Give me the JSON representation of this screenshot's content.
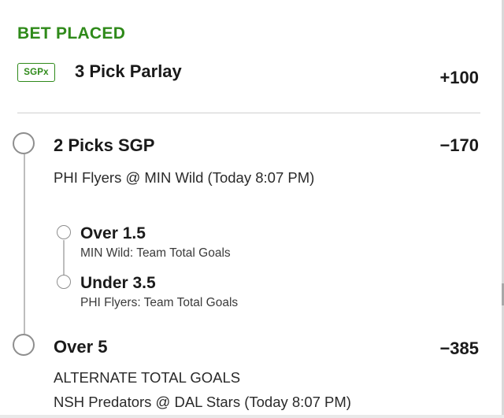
{
  "header": {
    "status": "BET PLACED",
    "badge": "SGPx",
    "title": "3 Pick Parlay",
    "odds": "+100"
  },
  "legs": [
    {
      "title": "2 Picks SGP",
      "odds": "−170",
      "game": "PHI Flyers @ MIN Wild (Today 8:07 PM)",
      "picks": [
        {
          "title": "Over 1.5",
          "market": "MIN Wild: Team Total Goals"
        },
        {
          "title": "Under 3.5",
          "market": "PHI Flyers: Team Total Goals"
        }
      ]
    },
    {
      "title": "Over 5",
      "odds": "−385",
      "market": "ALTERNATE TOTAL GOALS",
      "game": "NSH Predators @ DAL Stars (Today 8:07 PM)"
    }
  ],
  "colors": {
    "accent": "#2f8a1a",
    "text": "#1a1a1a",
    "node": "#8e8e8e"
  }
}
